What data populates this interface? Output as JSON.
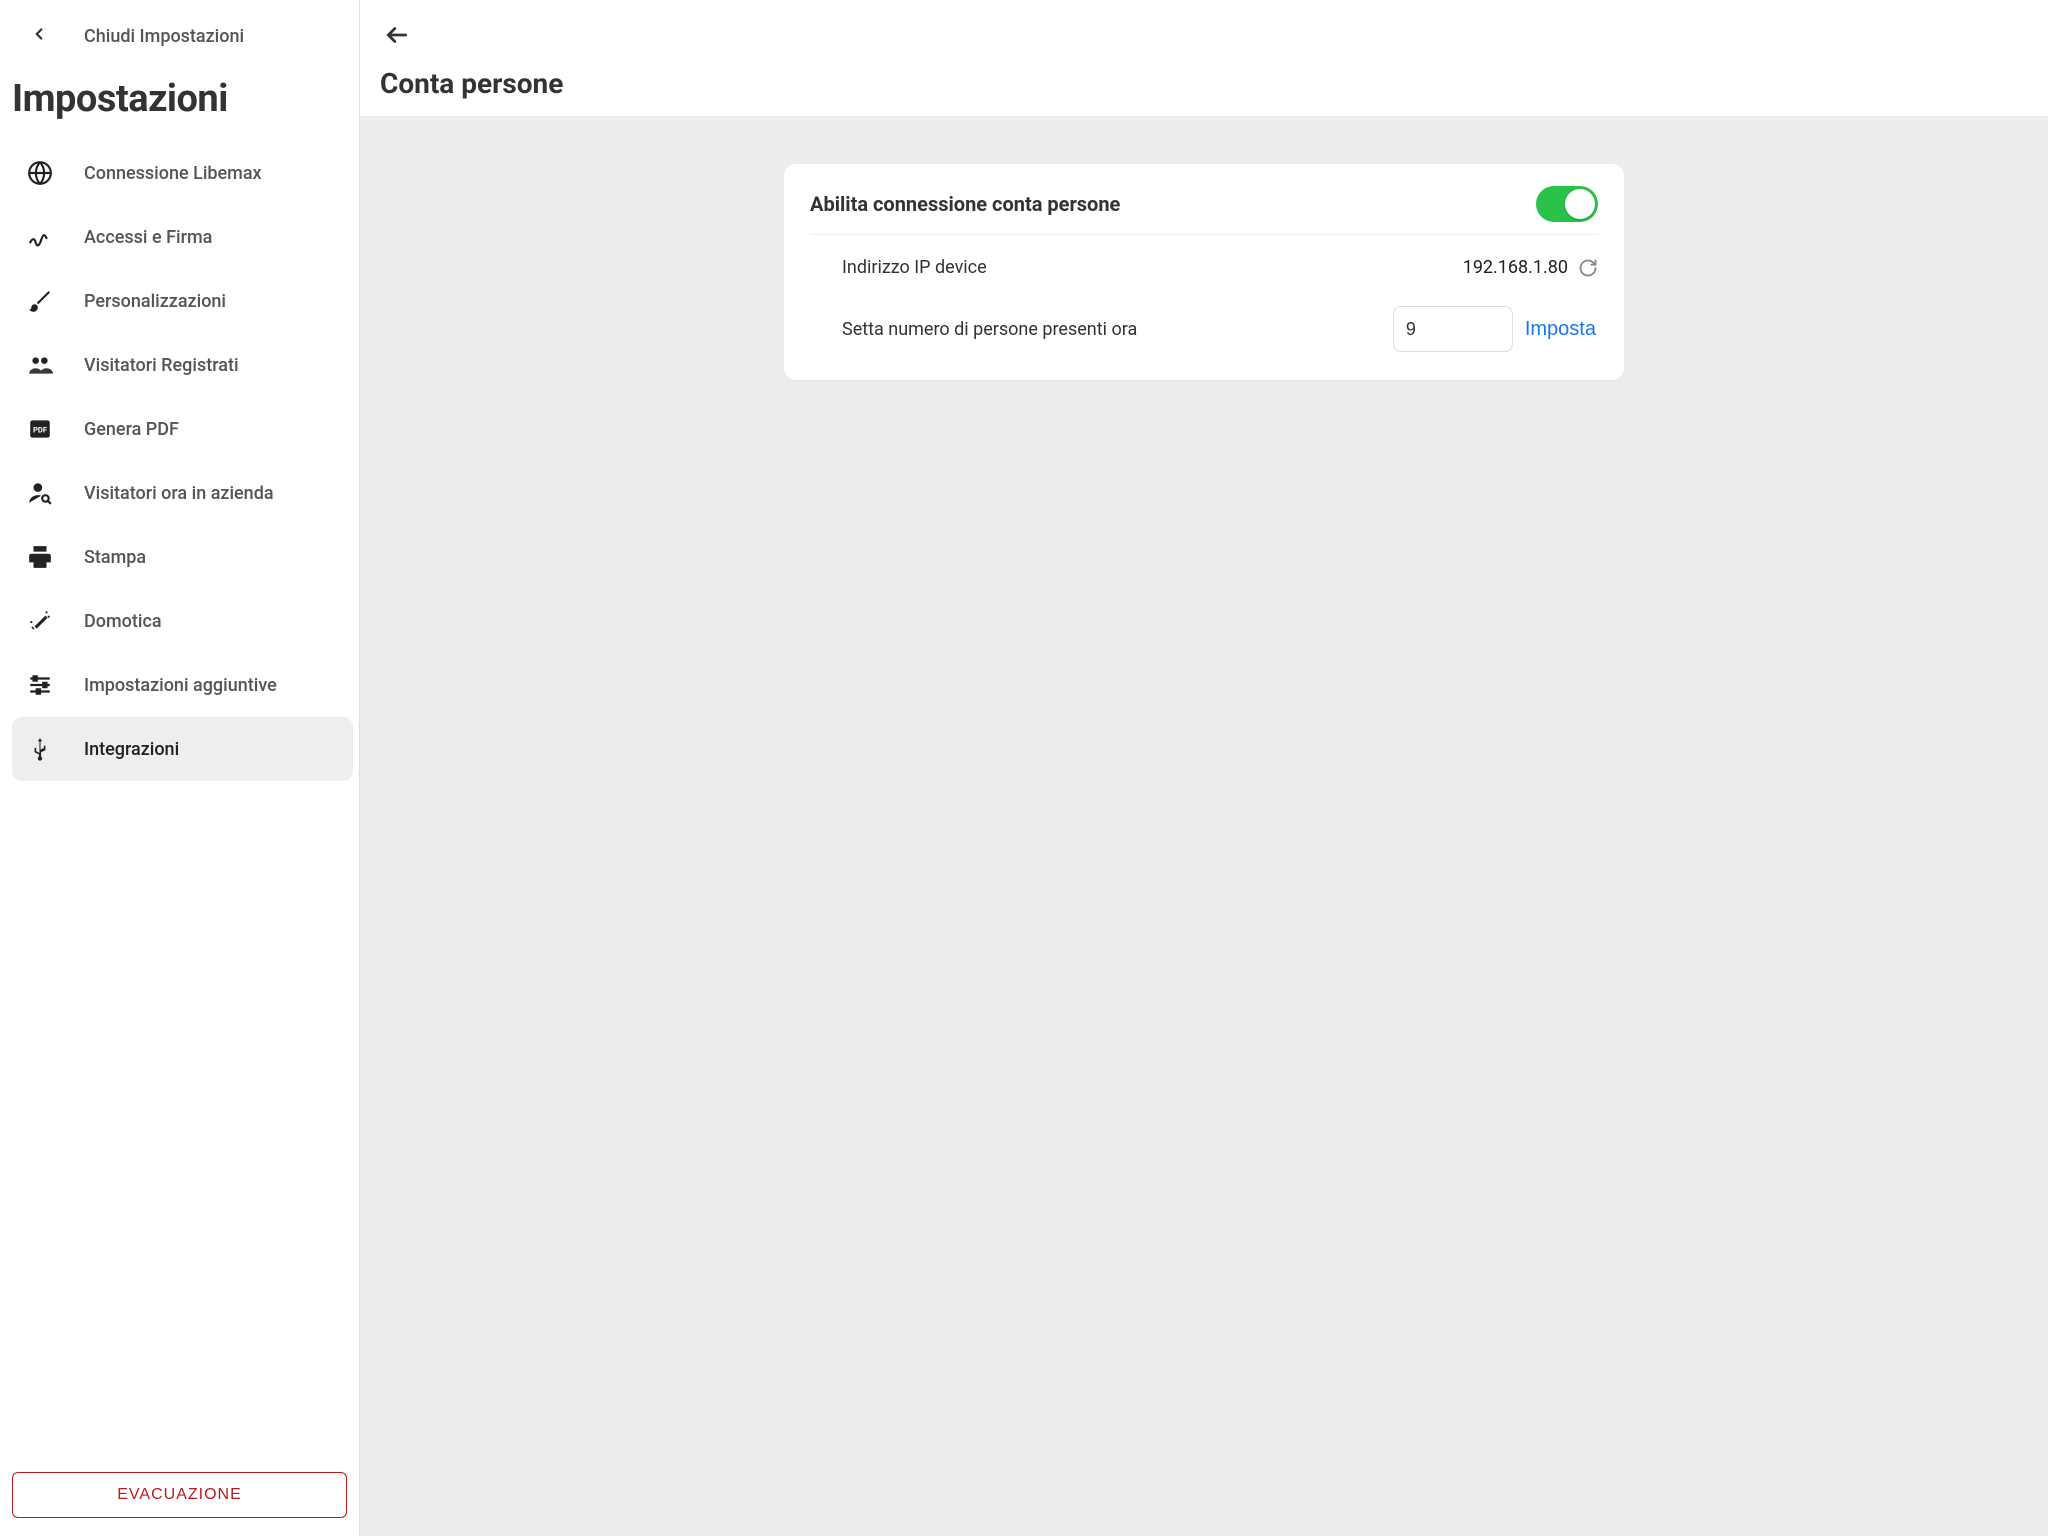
{
  "sidebar": {
    "close_label": "Chiudi Impostazioni",
    "title": "Impostazioni",
    "items": [
      {
        "label": "Connessione Libemax"
      },
      {
        "label": "Accessi e Firma"
      },
      {
        "label": "Personalizzazioni"
      },
      {
        "label": "Visitatori Registrati"
      },
      {
        "label": "Genera PDF"
      },
      {
        "label": "Visitatori ora in azienda"
      },
      {
        "label": "Stampa"
      },
      {
        "label": "Domotica"
      },
      {
        "label": "Impostazioni aggiuntive"
      },
      {
        "label": "Integrazioni"
      }
    ],
    "evacuation_label": "EVACUAZIONE"
  },
  "main": {
    "title": "Conta persone",
    "card": {
      "title": "Abilita connessione conta persone",
      "toggle_on": true,
      "ip_label": "Indirizzo IP device",
      "ip_value": "192.168.1.80",
      "set_label": "Setta numero di persone presenti ora",
      "set_value": "9",
      "set_button": "Imposta"
    }
  }
}
